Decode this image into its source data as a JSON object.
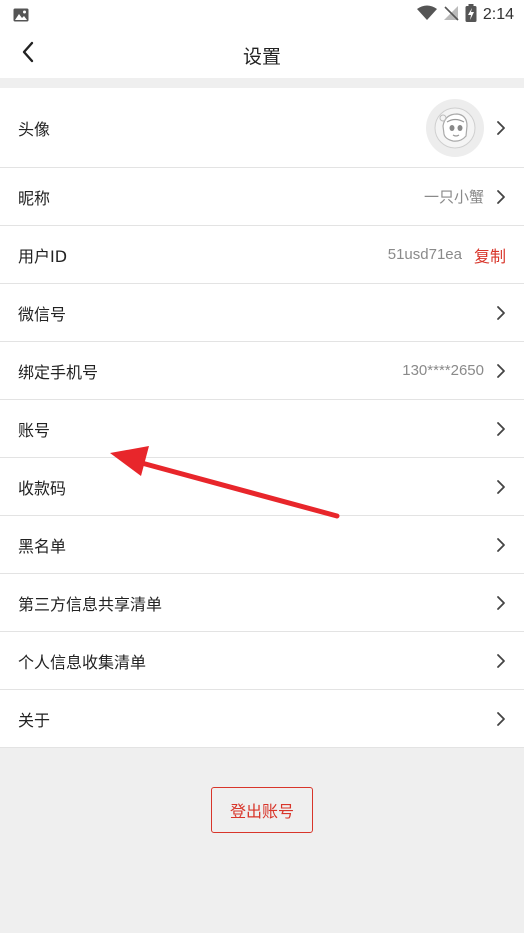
{
  "status_bar": {
    "time": "2:14",
    "icons": [
      "image-icon",
      "wifi-icon",
      "no-signal-icon",
      "battery-charging-icon"
    ]
  },
  "header": {
    "title": "设置",
    "back_icon": "back-arrow-icon"
  },
  "rows": [
    {
      "label": "头像",
      "value": "",
      "kind": "avatar"
    },
    {
      "label": "昵称",
      "value": "一只小蟹",
      "kind": "nav"
    },
    {
      "label": "用户ID",
      "value": "51usd71ea",
      "action": "复制",
      "kind": "copy"
    },
    {
      "label": "微信号",
      "value": "",
      "kind": "nav"
    },
    {
      "label": "绑定手机号",
      "value": "130****2650",
      "kind": "nav"
    },
    {
      "label": "账号",
      "value": "",
      "kind": "nav"
    },
    {
      "label": "收款码",
      "value": "",
      "kind": "nav"
    },
    {
      "label": "黑名单",
      "value": "",
      "kind": "nav"
    },
    {
      "label": "第三方信息共享清单",
      "value": "",
      "kind": "nav"
    },
    {
      "label": "个人信息收集清单",
      "value": "",
      "kind": "nav"
    },
    {
      "label": "关于",
      "value": "",
      "kind": "nav"
    }
  ],
  "logout": {
    "label": "登出账号"
  },
  "colors": {
    "accent": "#d8352a",
    "background": "#efefef",
    "annotation_arrow": "#e8262b"
  }
}
